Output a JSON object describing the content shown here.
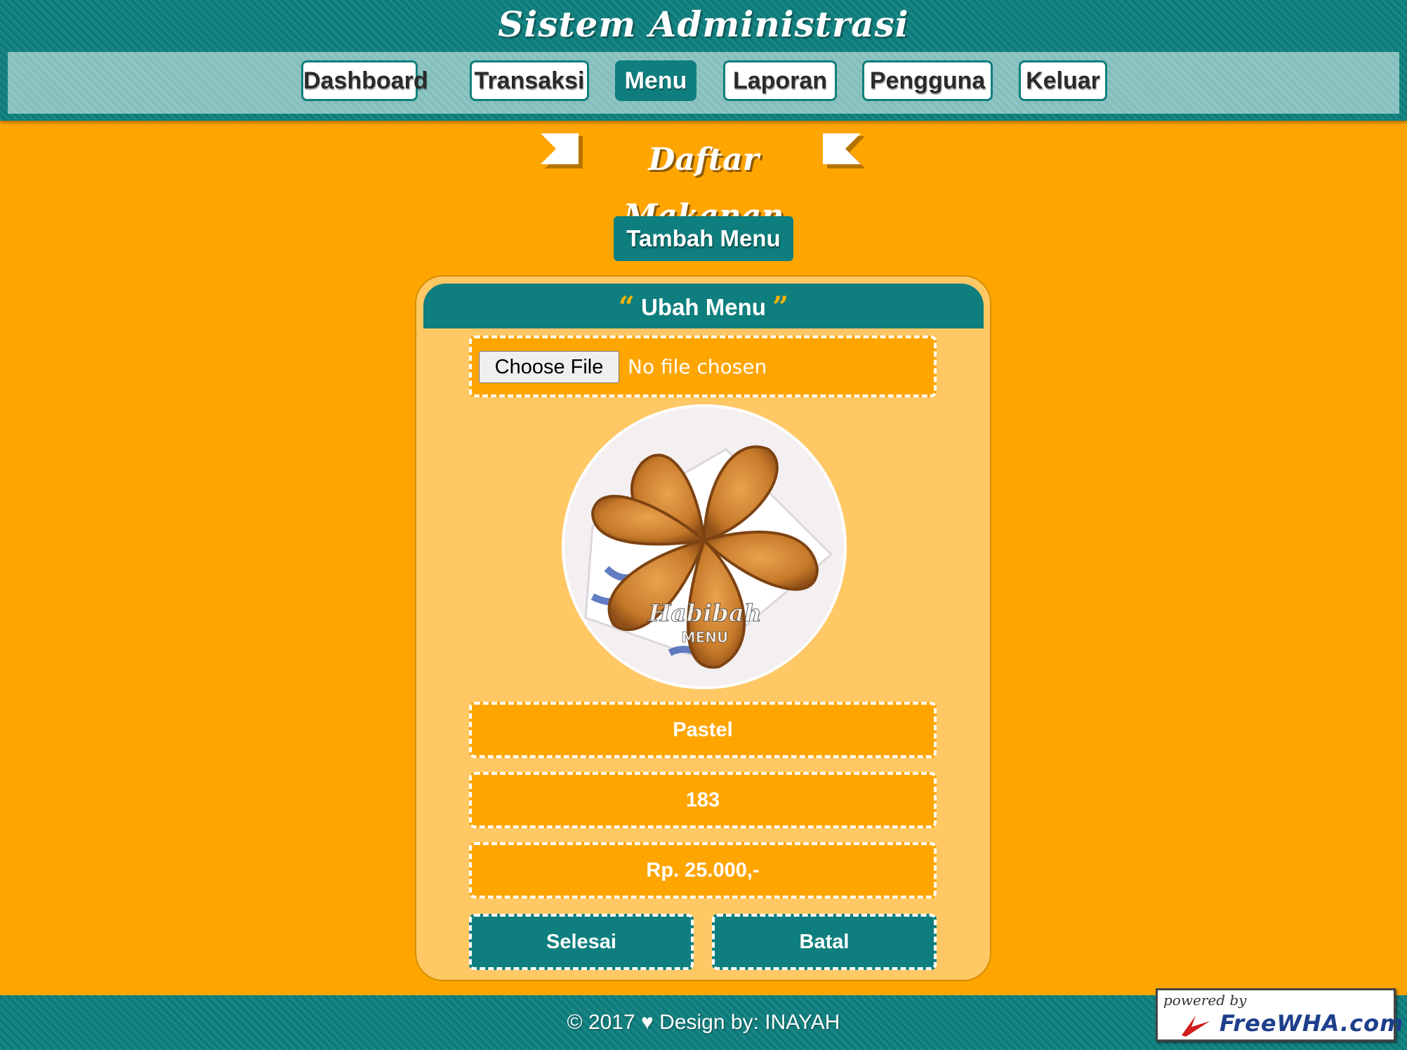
{
  "header": {
    "site_title": "Sistem Administrasi",
    "nav": [
      {
        "label": "Dashboard",
        "active": false
      },
      {
        "label": "Transaksi",
        "active": false
      },
      {
        "label": "Menu",
        "active": true
      },
      {
        "label": "Laporan",
        "active": false
      },
      {
        "label": "Pengguna",
        "active": false
      },
      {
        "label": "Keluar",
        "active": false
      }
    ]
  },
  "page": {
    "title": "Daftar Makanan",
    "add_button": "Tambah Menu"
  },
  "form": {
    "title": "Ubah Menu",
    "quote_open": "“",
    "quote_close": "”",
    "file_button": "Choose File",
    "file_status": "No file chosen",
    "photo_watermark": "Habibah",
    "photo_watermark_sub": "MENU",
    "name": "Pastel",
    "stock": "183",
    "price": "Rp. 25.000,-",
    "submit_button": "Selesai",
    "cancel_button": "Batal"
  },
  "footer": {
    "text": "© 2017 ♥ Design by: INAYAH",
    "badge_small": "powered by",
    "badge_brand": "FreeWHA.com"
  },
  "colors": {
    "page_background": "#ffa500",
    "teal": "#0e7f7e",
    "nav_bar": "#88c3c0",
    "panel": "#ffc865"
  }
}
